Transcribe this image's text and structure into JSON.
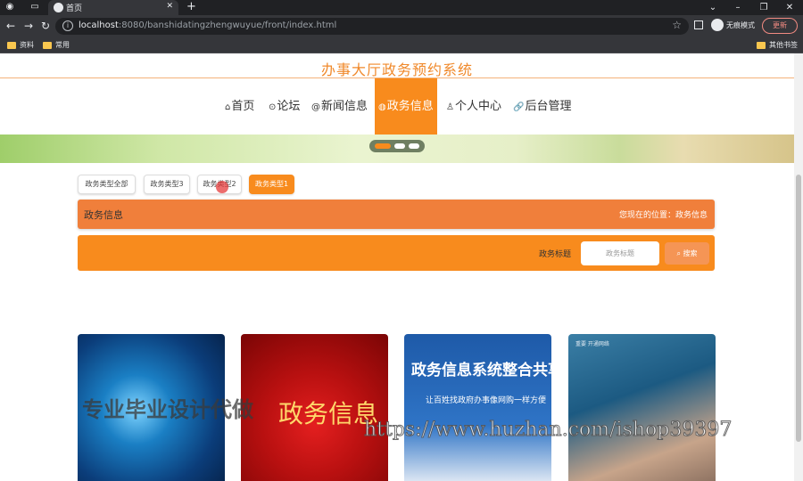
{
  "browser": {
    "tab_title": "首页",
    "url_host": "localhost",
    "url_rest": ":8080/banshidatingzhengwuyue/front/index.html",
    "incognito_label": "无痕模式",
    "update_label": "更新",
    "bookmarks": [
      "资料",
      "常用"
    ],
    "other_bookmarks": "其他书签"
  },
  "site": {
    "title": "办事大厅政务预约系统"
  },
  "nav": {
    "items": [
      {
        "icon": "home-icon",
        "label": "首页"
      },
      {
        "icon": "forum-icon",
        "label": "论坛"
      },
      {
        "icon": "news-icon",
        "label": "新闻信息"
      },
      {
        "icon": "gov-icon",
        "label": "政务信息"
      },
      {
        "icon": "user-icon",
        "label": "个人中心"
      },
      {
        "icon": "link-icon",
        "label": "后台管理"
      }
    ],
    "active_index": 3
  },
  "filters": {
    "items": [
      "政务类型全部",
      "政务类型3",
      "政务类型2",
      "政务类型1"
    ],
    "active_index": 3
  },
  "breadcrumb": {
    "title": "政务信息",
    "location": "您现在的位置：政务信息"
  },
  "search": {
    "label": "政务标题",
    "placeholder": "政务标题",
    "button_label": "搜索"
  },
  "cards": [
    {
      "text": ""
    },
    {
      "text": "政务信息"
    },
    {
      "text": "政务信息系统整合共享",
      "sub": "让百姓找政府办事像网购一样方便"
    },
    {
      "text": "重要 开通网络"
    }
  ],
  "watermarks": {
    "left": "专业毕业设计代做",
    "right": "https://www.huzhan.com/ishop39397"
  },
  "colors": {
    "accent": "#f88b1d",
    "breadcrumb_bg": "#f07f3b",
    "title_color": "#f0892b"
  }
}
